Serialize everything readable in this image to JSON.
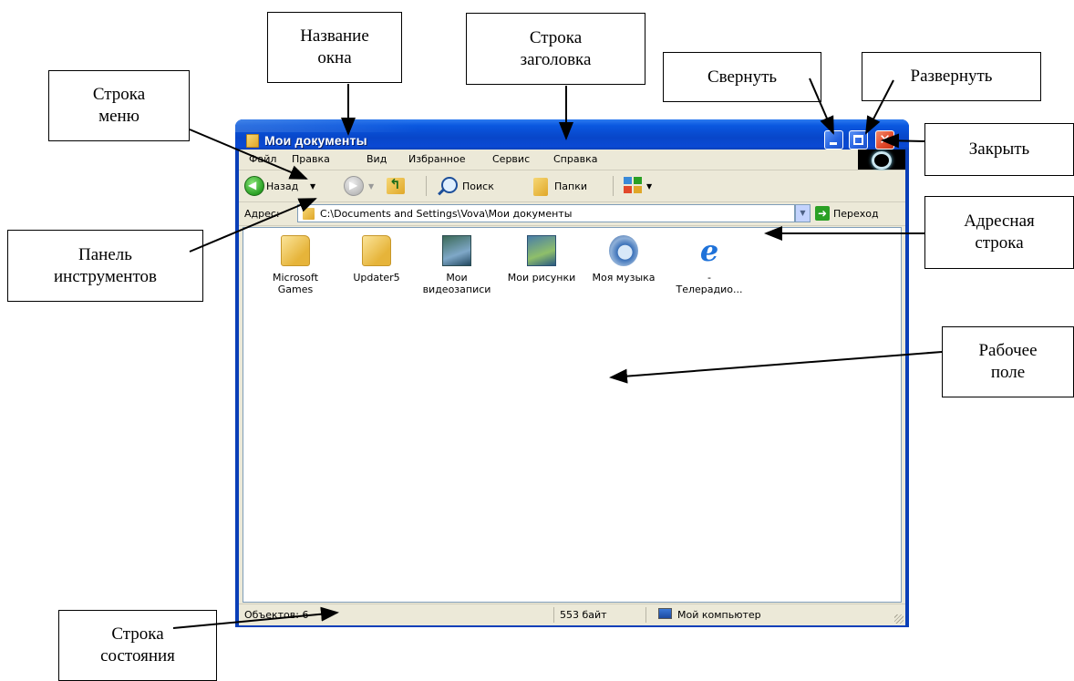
{
  "window": {
    "title": "Мои документы",
    "menu": [
      "Файл",
      "Правка",
      "Вид",
      "Избранное",
      "Сервис",
      "Справка"
    ],
    "toolbar": {
      "back": "Назад",
      "search": "Поиск",
      "folders": "Папки"
    },
    "address": {
      "label": "Адрес:",
      "path": "C:\\Documents and Settings\\Vova\\Мои документы",
      "go": "Переход"
    },
    "items": [
      {
        "label": "Microsoft\nGames",
        "icon": "folder-icon"
      },
      {
        "label": "Updater5",
        "icon": "folder-icon"
      },
      {
        "label": "Мои\nвидеозаписи",
        "icon": "my-videos-icon"
      },
      {
        "label": "Мои рисунки",
        "icon": "my-pictures-icon"
      },
      {
        "label": "Моя музыка",
        "icon": "my-music-icon"
      },
      {
        "label": "-\nТелерадио...",
        "icon": "internet-explorer-icon"
      }
    ],
    "status": {
      "objects": "Объектов: 6",
      "size": "553 байт",
      "location": "Мой компьютер"
    }
  },
  "callouts": {
    "window_name": "Название\nокна",
    "title_bar": "Строка\nзаголовка",
    "minimize": "Свернуть",
    "maximize": "Развернуть",
    "close": "Закрыть",
    "menu_bar": "Строка\nменю",
    "toolbar": "Панель\nинструментов",
    "address_bar": "Адресная\nстрока",
    "workspace": "Рабочее\nполе",
    "status_bar": "Строка\nсостояния"
  }
}
